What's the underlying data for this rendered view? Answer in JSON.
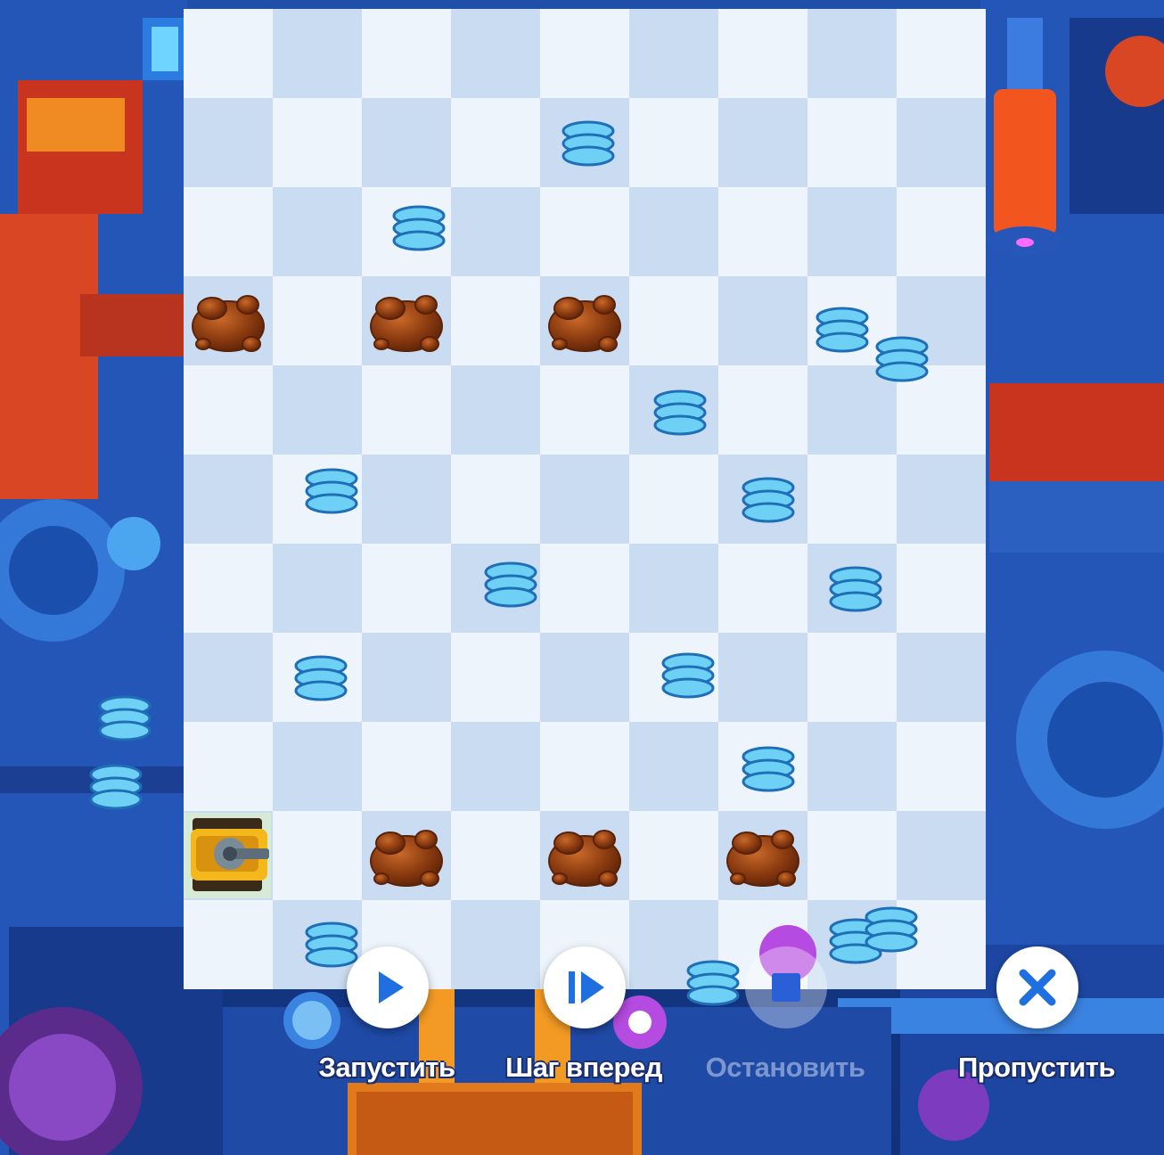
{
  "game": {
    "controls": {
      "run_label": "Запустить",
      "step_label": "Шаг вперед",
      "stop_label": "Остановить",
      "skip_label": "Пропустить"
    },
    "icons": {
      "run": "play-icon",
      "step": "step-forward-icon",
      "stop": "stop-icon",
      "skip": "close-icon"
    },
    "colors": {
      "button_blue": "#1f6fe0",
      "label_outline": "#1a2f6e",
      "coil": "#6fd0f5",
      "oil": "#8a3a0f",
      "robot": "#f4b81c"
    }
  }
}
